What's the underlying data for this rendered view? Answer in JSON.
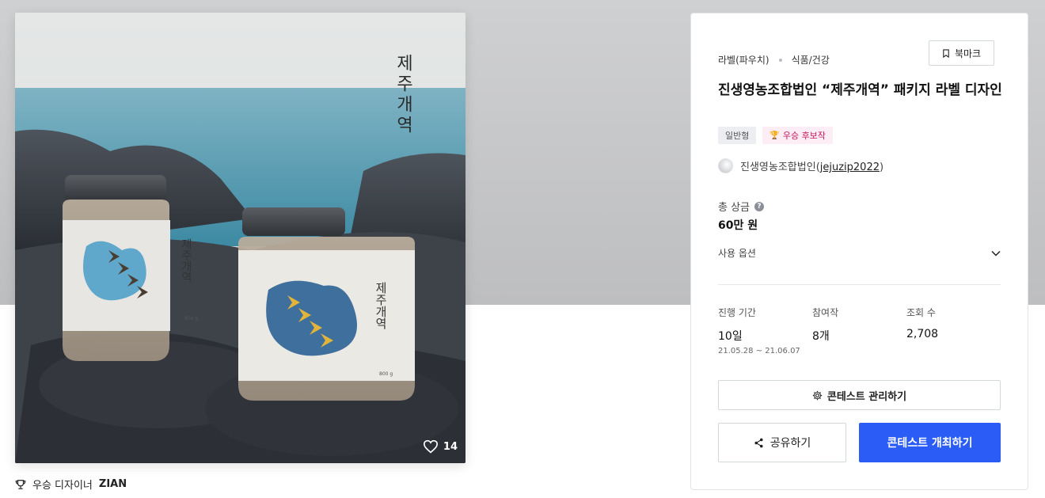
{
  "colors": {
    "primary_button": "#2b5cf5",
    "award_tag_text": "#c2185b",
    "award_tag_bg": "#fdeef6"
  },
  "image": {
    "vertical_brand_text": "제주개역",
    "jar_label_text": "제주개역",
    "jar_weight": "800 g",
    "like_count": "14"
  },
  "winner": {
    "label": "우승 디자이너",
    "name": "ZIAN"
  },
  "panel": {
    "category_primary": "라벨(파우치)",
    "category_secondary": "식품/건강",
    "bookmark_label": "북마크",
    "title": "진생영농조합법인 “제주개역” 패키지 라벨 디자인",
    "tags": {
      "general": "일반형",
      "award": "우승 후보작"
    },
    "host_name": "진생영농조합법인",
    "host_id": "jejuzip2022",
    "prize_label": "총 상금",
    "prize_value": "60만 원",
    "options_label": "사용 옵션",
    "stats": {
      "period_label": "진행 기간",
      "period_value": "10일",
      "period_range": "21.05.28 ~ 21.06.07",
      "entries_label": "참여작",
      "entries_value": "8개",
      "views_label": "조회 수",
      "views_value": "2,708"
    },
    "manage_button": "콘테스트 관리하기",
    "share_button": "공유하기",
    "host_button": "콘테스트 개최하기"
  }
}
